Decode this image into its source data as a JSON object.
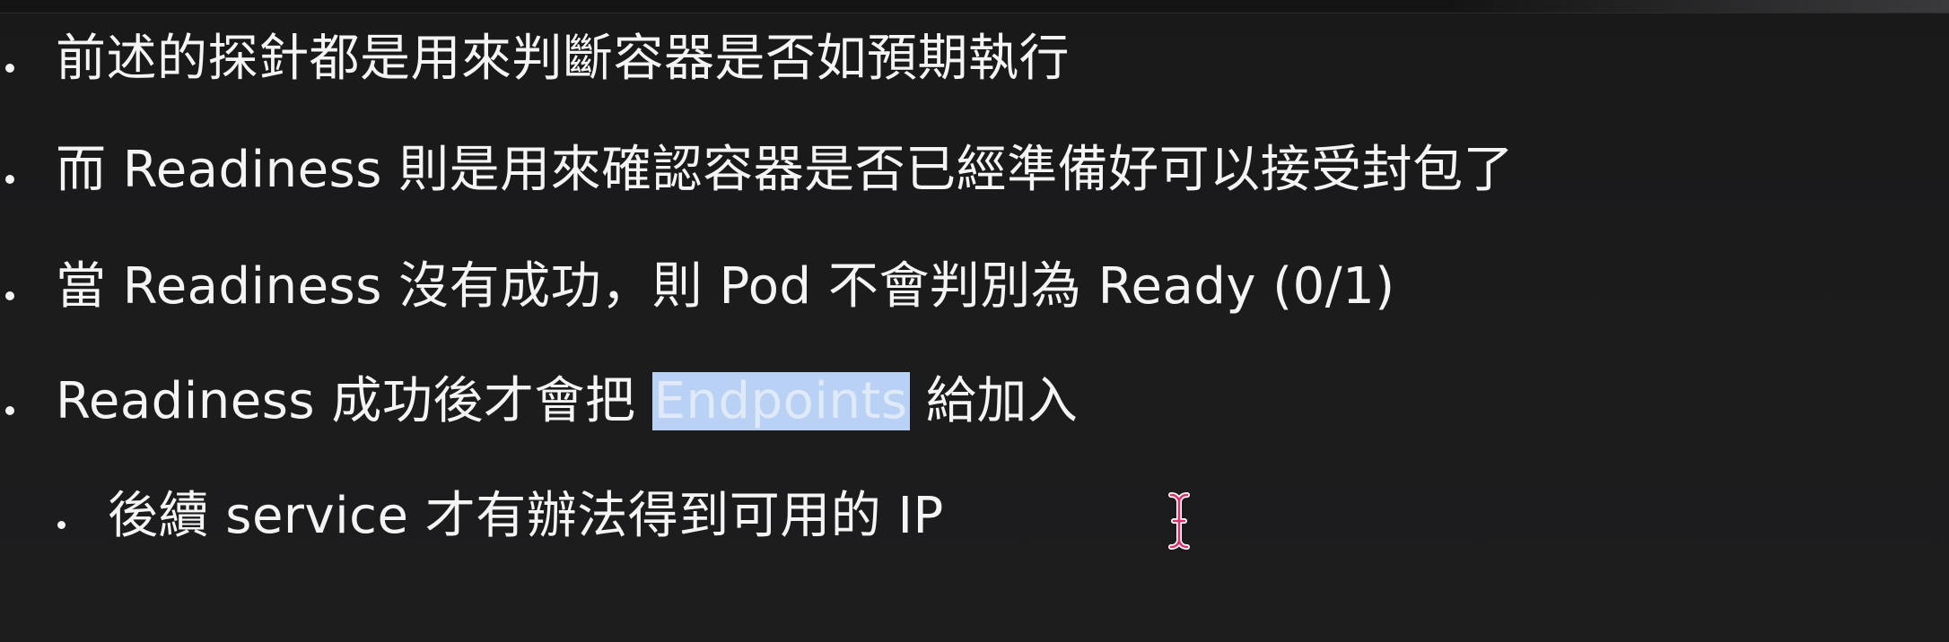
{
  "bullets": [
    {
      "text": "前述的探針都是用來判斷容器是否如預期執行",
      "level": 0
    },
    {
      "text": "而 Readiness 則是用來確認容器是否已經準備好可以接受封包了",
      "level": 0
    },
    {
      "text": "當 Readiness 沒有成功，則 Pod 不會判別為 Ready (0/1)",
      "level": 0
    },
    {
      "pre": "Readiness 成功後才會把 ",
      "highlight": "Endpoints",
      "post": " 給加入",
      "level": 0
    },
    {
      "text": "後續 service 才有辦法得到可用的 IP",
      "level": 1
    }
  ],
  "colors": {
    "background": "#1a1a1b",
    "text": "#f4f4f4",
    "selection": "#b8d1f5",
    "cursor": "#e0306a"
  },
  "icons": {
    "cursor": "text-cursor-icon"
  }
}
